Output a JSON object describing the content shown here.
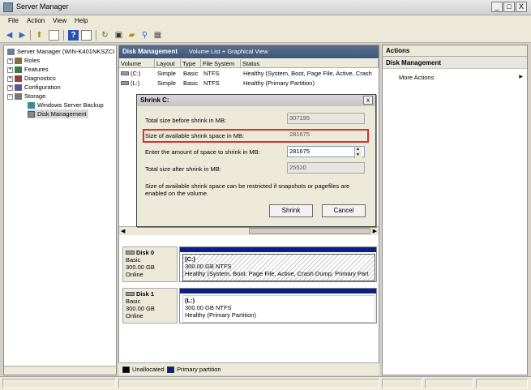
{
  "window": {
    "title": "Server Manager",
    "buttons": {
      "minimize": "_",
      "restore": "□",
      "close": "X"
    }
  },
  "menu": [
    "File",
    "Action",
    "View",
    "Help"
  ],
  "toolbar": [
    "back-icon",
    "forward-icon",
    "up-icon",
    "show-hide-tree-icon",
    "help-icon",
    "properties-icon",
    "refresh-icon",
    "export-icon",
    "open-icon",
    "find-icon",
    "settings-icon"
  ],
  "tree": {
    "root": "Server Manager (WIN-K401NKSZCI",
    "items": [
      {
        "label": "Roles",
        "exp": "+"
      },
      {
        "label": "Features",
        "exp": "+"
      },
      {
        "label": "Diagnostics",
        "exp": "+"
      },
      {
        "label": "Configuration",
        "exp": "+"
      },
      {
        "label": "Storage",
        "exp": "−"
      }
    ],
    "storage_children": [
      "Windows Server Backup",
      "Disk Management"
    ]
  },
  "center": {
    "title": "Disk Management",
    "view": "Volume List + Graphical View",
    "columns": [
      "Volume",
      "Layout",
      "Type",
      "File System",
      "Status"
    ],
    "rows": [
      {
        "volume": "(C:)",
        "layout": "Simple",
        "type": "Basic",
        "fs": "NTFS",
        "status": "Healthy (System, Boot, Page File, Active, Crash"
      },
      {
        "volume": "(L:)",
        "layout": "Simple",
        "type": "Basic",
        "fs": "NTFS",
        "status": "Healthy (Primary Partition)"
      }
    ]
  },
  "dialog": {
    "title": "Shrink C:",
    "close": "x",
    "total_before_label": "Total size before shrink in MB:",
    "total_before_value": "307195",
    "available_label": "Size of available shrink space in MB:",
    "available_value": "281675",
    "enter_label": "Enter the amount of space to shrink in MB:",
    "enter_value": "281675",
    "total_after_label": "Total size after shrink in MB:",
    "total_after_value": "25520",
    "note": "Size of available shrink space can be restricted if snapshots or pagefiles are enabled on the volume.",
    "shrink_button": "Shrink",
    "cancel_button": "Cancel",
    "highlight_color": "#d63131"
  },
  "disks": [
    {
      "name": "Disk 0",
      "type": "Basic",
      "size": "300.00 GB",
      "state": "Online",
      "partition": {
        "letter": "(C:)",
        "size": "300.00 GB NTFS",
        "status": "Healthy (System, Boot, Page File, Active, Crash Dump, Primary Part"
      }
    },
    {
      "name": "Disk 1",
      "type": "Basic",
      "size": "300.00 GB",
      "state": "Online",
      "partition": {
        "letter": "(L:)",
        "size": "300.00 GB NTFS",
        "status": "Healthy (Primary Partition)"
      }
    }
  ],
  "legend": [
    {
      "label": "Unallocated",
      "color": "#000000"
    },
    {
      "label": "Primary partition",
      "color": "#0a1e8a"
    }
  ],
  "actions": {
    "header": "Actions",
    "section": "Disk Management",
    "items": [
      "More Actions"
    ]
  },
  "colors": {
    "header_blue": "#3e5679",
    "partition_blue": "#0a1e8a",
    "highlight_red": "#d63131"
  }
}
